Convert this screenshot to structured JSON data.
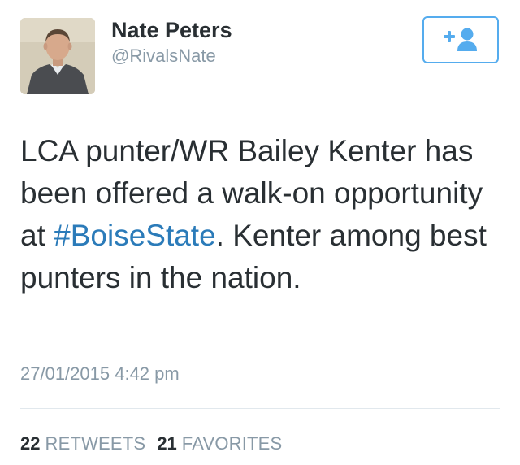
{
  "author": {
    "display_name": "Nate Peters",
    "handle": "@RivalsNate",
    "avatar_icon": "profile-photo"
  },
  "follow_button": {
    "icon": "follow-user-icon",
    "color": "#55acee"
  },
  "tweet": {
    "text_before": "LCA punter/WR Bailey Kenter has been offered a walk-on opportunity at ",
    "hashtag": "#BoiseState",
    "text_after": ". Kenter among best punters in the nation.",
    "hashtag_color": "#2b7bb9"
  },
  "timestamp": "27/01/2015 4:42 pm",
  "stats": {
    "retweets_count": "22",
    "retweets_label": "RETWEETS",
    "favorites_count": "21",
    "favorites_label": "FAVORITES"
  }
}
